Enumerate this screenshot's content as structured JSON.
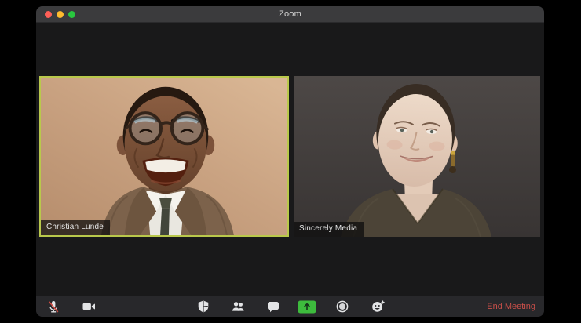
{
  "window": {
    "title": "Zoom",
    "traffic_lights": [
      {
        "name": "close",
        "color": "#fe5f57"
      },
      {
        "name": "minimize",
        "color": "#febb2e"
      },
      {
        "name": "zoom",
        "color": "#29c73f"
      }
    ]
  },
  "video_tiles": [
    {
      "name": "Christian Lunde",
      "active_speaker": true,
      "description": "laughing man with round glasses, tweed blazer, white shirt and dark tie on tan background"
    },
    {
      "name": "Sincerely Media",
      "active_speaker": false,
      "description": "woman with buzzed hair, olive top and gold drop earring on dark gray background"
    }
  ],
  "toolbar": {
    "buttons": [
      {
        "id": "mute",
        "icon": "microphone-muted-icon",
        "state": "muted"
      },
      {
        "id": "video",
        "icon": "video-camera-icon"
      },
      {
        "id": "security",
        "icon": "security-shield-icon"
      },
      {
        "id": "participants",
        "icon": "participants-icon"
      },
      {
        "id": "chat",
        "icon": "chat-icon"
      },
      {
        "id": "share-screen",
        "icon": "share-screen-icon"
      },
      {
        "id": "record",
        "icon": "record-icon"
      },
      {
        "id": "reactions",
        "icon": "reactions-icon"
      }
    ],
    "end_meeting_label": "End Meeting"
  },
  "colors": {
    "active_speaker_border": "#b9c84b",
    "end_meeting_text": "#c94f49",
    "share_accent": "#3dbb3d",
    "titlebar": "#3b3b3d",
    "toolbar": "#28282b",
    "window_bg": "#19191a",
    "mute_slash": "#cf4b42"
  }
}
